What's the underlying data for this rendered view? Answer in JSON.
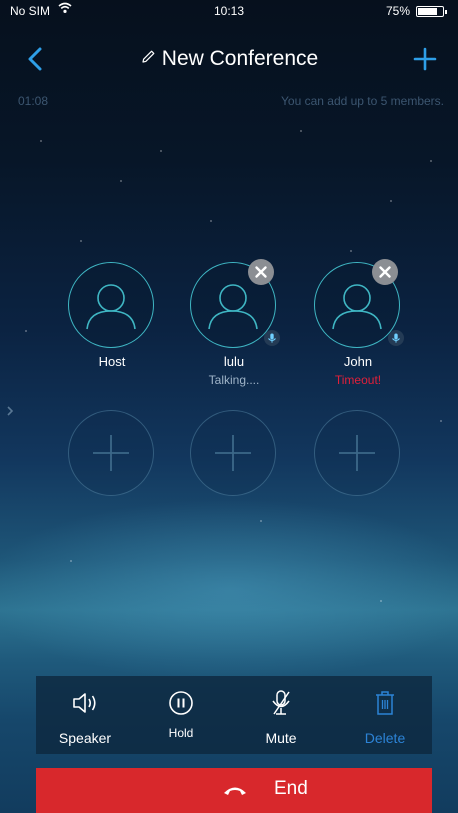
{
  "status_bar": {
    "carrier": "No SIM",
    "time": "10:13",
    "battery": "75%",
    "icons": [
      "wifi-icon",
      "battery-icon"
    ]
  },
  "nav": {
    "title": "New Conference",
    "icons": [
      "back-chevron-icon",
      "pencil-icon",
      "plus-icon"
    ]
  },
  "info": {
    "timer": "01:08",
    "limit_note": "You can add up to 5 members."
  },
  "participants": [
    {
      "name": "Host",
      "status": "",
      "removable": false
    },
    {
      "name": "lulu",
      "status": "Talking....",
      "removable": true
    },
    {
      "name": "John",
      "status": "Timeout!",
      "removable": true
    }
  ],
  "empty_slot_count": 3,
  "controls": {
    "speaker": "Speaker",
    "hold": "Hold",
    "mute": "Mute",
    "delete": "Delete"
  },
  "end_call": {
    "label": "End"
  },
  "colors": {
    "accent": "#2e9fe8",
    "avatar_ring": "#3fb6c3",
    "end_red": "#d8282c",
    "timeout_red": "#e0203a",
    "muted_text": "#3c5670",
    "delete_blue": "#2c83d6"
  }
}
